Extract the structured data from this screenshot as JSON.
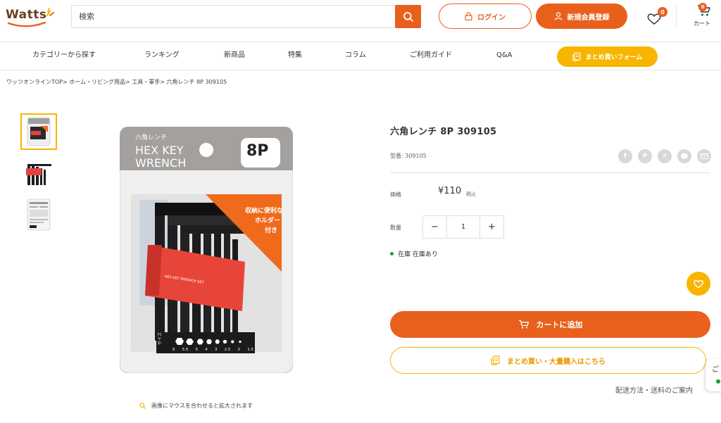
{
  "header": {
    "logo_text": "Watts",
    "search_placeholder": "検索",
    "login_label": "ログイン",
    "register_label": "新規会員登録",
    "favorites_count": "0",
    "cart_count": "0",
    "cart_label": "カート"
  },
  "nav": {
    "items": [
      {
        "label": "カテゴリーから探す"
      },
      {
        "label": "ランキング"
      },
      {
        "label": "新商品"
      },
      {
        "label": "特集"
      },
      {
        "label": "コラム"
      },
      {
        "label": "ご利用ガイド"
      },
      {
        "label": "Q&A"
      }
    ],
    "bulk_form_label": "まとめ買いフォーム"
  },
  "breadcrumb": {
    "items": [
      "ワッツオンラインTOP",
      "ホーム・リビング用品",
      "工具・軍手",
      "六角レンチ 8P 309105"
    ],
    "separator": ">"
  },
  "product": {
    "title": "六角レンチ 8P 309105",
    "model": "型番: 309105",
    "price_label": "価格",
    "price": "¥110",
    "tax_label": "税込",
    "quantity_label": "数量",
    "quantity": "1",
    "stock_text": "在庫 在庫あり",
    "add_to_cart": "カートに追加",
    "bulk_buy": "まとめ買い・大量購入はこちら",
    "shipping_link": "配送方法・送料のご案内",
    "zoom_hint": "画像にマウスを合わせると拡大されます"
  },
  "package": {
    "jp_name": "六角レンチ",
    "title_line1": "HEX KEY",
    "title_line2": "WRENCH",
    "count": "8P",
    "callout_line1": "収納に便利な",
    "callout_line2": "ホルダー",
    "callout_line3": "付き",
    "holder_text": "HEX KEY WRENCH SET",
    "size_label": "サイズ",
    "sizes": [
      "6",
      "5.5",
      "5",
      "4",
      "3",
      "2.5",
      "2",
      "1.5"
    ]
  },
  "chat_tab": {
    "label": "ご"
  },
  "colors": {
    "accent": "#e8601c",
    "yellow": "#f7b500",
    "stock_green": "#1a9d3a",
    "share_gray": "#d8d8d8"
  },
  "icons": {
    "search": "search-icon",
    "lock": "lock-icon",
    "user": "user-icon",
    "heart": "heart-icon",
    "cart": "cart-icon",
    "document": "document-icon",
    "share": [
      "facebook-icon",
      "pinterest-icon",
      "x-icon",
      "line-icon",
      "mail-icon"
    ]
  }
}
